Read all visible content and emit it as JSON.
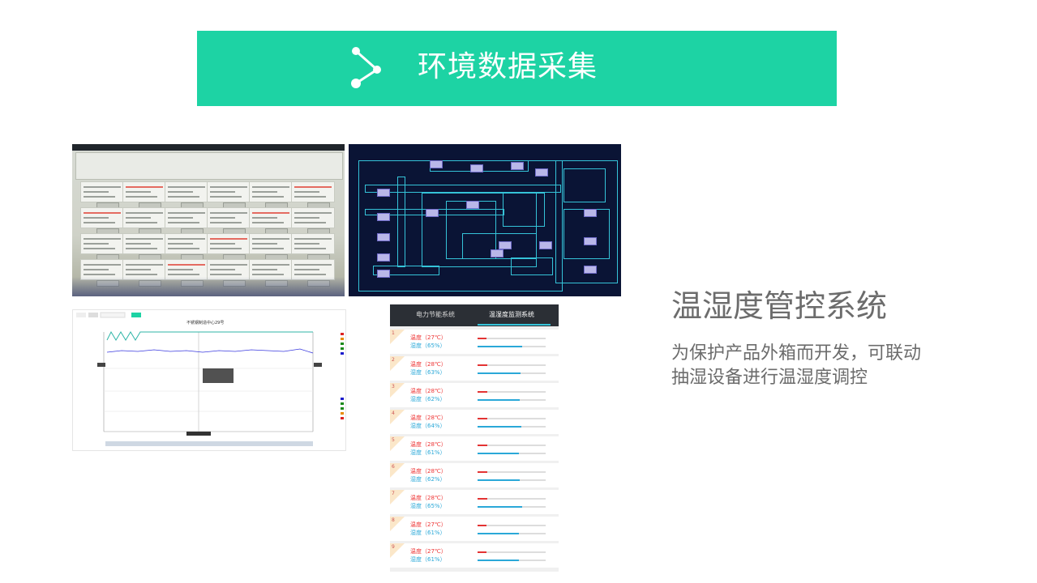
{
  "banner": {
    "title": "环境数据采集",
    "color": "#1dd3a4",
    "icon": "share-node-icon"
  },
  "system": {
    "title": "温湿度管控系统",
    "description": "为保护产品外箱而开发，可联动抽湿设备进行温湿度调控"
  },
  "mobile": {
    "tabs": [
      "电力节能系统",
      "温湿度监测系统"
    ],
    "active_tab": 1,
    "rows": [
      {
        "num": "1",
        "temp": "温度（27℃）",
        "hum": "湿度（65%）",
        "temp_value": 27,
        "hum_value": 65
      },
      {
        "num": "2",
        "temp": "温度（28℃）",
        "hum": "湿度（63%）",
        "temp_value": 28,
        "hum_value": 63
      },
      {
        "num": "3",
        "temp": "温度（28℃）",
        "hum": "湿度（62%）",
        "temp_value": 28,
        "hum_value": 62
      },
      {
        "num": "4",
        "temp": "温度（28℃）",
        "hum": "湿度（64%）",
        "temp_value": 28,
        "hum_value": 64
      },
      {
        "num": "5",
        "temp": "温度（28℃）",
        "hum": "湿度（61%）",
        "temp_value": 28,
        "hum_value": 61
      },
      {
        "num": "6",
        "temp": "温度（28℃）",
        "hum": "湿度（62%）",
        "temp_value": 28,
        "hum_value": 62
      },
      {
        "num": "7",
        "temp": "温度（28℃）",
        "hum": "湿度（65%）",
        "temp_value": 28,
        "hum_value": 65
      },
      {
        "num": "8",
        "temp": "温度（27℃）",
        "hum": "湿度（61%）",
        "temp_value": 27,
        "hum_value": 61
      },
      {
        "num": "9",
        "temp": "温度（27℃）",
        "hum": "湿度（61%）",
        "temp_value": 27,
        "hum_value": 61
      }
    ],
    "temp_color": "#e33333",
    "hum_color": "#2aa8d8"
  },
  "chart": {
    "title": "不锈钢制造中心29号"
  }
}
